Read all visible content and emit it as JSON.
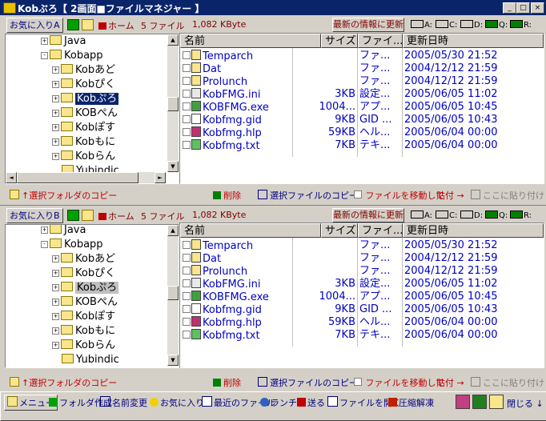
{
  "window": {
    "title": "Kobぶろ【 2画面■ファイルマネジャー 】",
    "btn_min": "_",
    "btn_max": "□",
    "btn_close": "×"
  },
  "pane_top": {
    "fav": "お気に入りA",
    "home": "ホーム",
    "count": "5 ファイル",
    "size": "1,082 KByte",
    "refresh": "最新の情報に更新",
    "drives": [
      "A:",
      "C:",
      "D:",
      "Q:",
      "R:"
    ],
    "tree": [
      {
        "label": "Java",
        "expand": "+"
      },
      {
        "label": "Kobapp",
        "expand": "-"
      },
      {
        "label": "Kobあど",
        "expand": "+"
      },
      {
        "label": "Kobぴく",
        "expand": "+"
      },
      {
        "label": "Kobぷろ",
        "expand": "+"
      },
      {
        "label": "KOBぺん",
        "expand": "+"
      },
      {
        "label": "Kobぽす",
        "expand": "+"
      },
      {
        "label": "Kobもに",
        "expand": "+"
      },
      {
        "label": "Kobらん",
        "expand": "+"
      },
      {
        "label": "Yubindic",
        "expand": ""
      }
    ],
    "columns": {
      "name": "名前",
      "size": "サイズ",
      "type": "ファイ...",
      "date": "更新日時"
    },
    "files": [
      {
        "name": "Temparch",
        "size": "",
        "type": "ファ...",
        "date": "2005/05/30 21:52",
        "icon": "folder-icon"
      },
      {
        "name": "Dat",
        "size": "",
        "type": "ファ...",
        "date": "2004/12/12 21:59",
        "icon": "folder-icon"
      },
      {
        "name": "Prolunch",
        "size": "",
        "type": "ファ...",
        "date": "2004/12/12 21:59",
        "icon": "folder-icon"
      },
      {
        "name": "KobFMG.ini",
        "size": "3KB",
        "type": "設定...",
        "date": "2005/06/05 11:02",
        "icon": "ini-icon"
      },
      {
        "name": "KOBFMG.exe",
        "size": "1004...",
        "type": "アプ...",
        "date": "2005/06/05 10:45",
        "icon": "exe-icon"
      },
      {
        "name": "Kobfmg.gid",
        "size": "9KB",
        "type": "GID ...",
        "date": "2005/06/05 10:43",
        "icon": "gid-icon"
      },
      {
        "name": "Kobfmg.hlp",
        "size": "59KB",
        "type": "ヘル...",
        "date": "2005/06/04 00:00",
        "icon": "help-icon"
      },
      {
        "name": "Kobfmg.txt",
        "size": "7KB",
        "type": "テキ...",
        "date": "2005/06/04 00:00",
        "icon": "txt-icon"
      }
    ]
  },
  "pane_bottom": {
    "fav": "お気に入りB",
    "home": "ホーム",
    "count": "5 ファイル",
    "size": "1,082 KByte",
    "refresh": "最新の情報に更新",
    "drives": [
      "A:",
      "C:",
      "D:",
      "Q:",
      "R:"
    ],
    "tree": [
      {
        "label": "Java",
        "expand": "+"
      },
      {
        "label": "Kobapp",
        "expand": "-"
      },
      {
        "label": "Kobあど",
        "expand": "+"
      },
      {
        "label": "Kobぴく",
        "expand": "+"
      },
      {
        "label": "Kobぷろ",
        "expand": "+"
      },
      {
        "label": "KOBぺん",
        "expand": "+"
      },
      {
        "label": "Kobぽす",
        "expand": "+"
      },
      {
        "label": "Kobもに",
        "expand": "+"
      },
      {
        "label": "Kobらん",
        "expand": "+"
      },
      {
        "label": "Yubindic",
        "expand": ""
      }
    ],
    "columns": {
      "name": "名前",
      "size": "サイズ",
      "type": "ファイ...",
      "date": "更新日時"
    },
    "files": [
      {
        "name": "Temparch",
        "size": "",
        "type": "ファ...",
        "date": "2005/05/30 21:52",
        "icon": "folder-icon"
      },
      {
        "name": "Dat",
        "size": "",
        "type": "ファ...",
        "date": "2004/12/12 21:59",
        "icon": "folder-icon"
      },
      {
        "name": "Prolunch",
        "size": "",
        "type": "ファ...",
        "date": "2004/12/12 21:59",
        "icon": "folder-icon"
      },
      {
        "name": "KobFMG.ini",
        "size": "3KB",
        "type": "設定...",
        "date": "2005/06/05 11:02",
        "icon": "ini-icon"
      },
      {
        "name": "KOBFMG.exe",
        "size": "1004...",
        "type": "アプ...",
        "date": "2005/06/05 10:45",
        "icon": "exe-icon"
      },
      {
        "name": "Kobfmg.gid",
        "size": "9KB",
        "type": "GID ...",
        "date": "2005/06/05 10:43",
        "icon": "gid-icon"
      },
      {
        "name": "Kobfmg.hlp",
        "size": "59KB",
        "type": "ヘル...",
        "date": "2005/06/04 00:00",
        "icon": "help-icon"
      },
      {
        "name": "Kobfmg.txt",
        "size": "7KB",
        "type": "テキ...",
        "date": "2005/06/04 00:00",
        "icon": "txt-icon"
      }
    ]
  },
  "actions": {
    "copy_folder": "↑選択フォルダのコピー",
    "delete": "削除",
    "copy_files": "選択ファイルのコピー",
    "move_files": "ファイルを移動して",
    "paste": "貼付 →",
    "paste_here": "ここに貼り付け"
  },
  "bottom": {
    "menu": "メニュー",
    "mkdir": "フォルダ作成",
    "rename": "名前変更",
    "favorites": "お気に入り",
    "recent": "最近のファイル",
    "launch": "ランチ",
    "send": "送る",
    "open_file": "ファイルを開く",
    "extract": "圧縮解凍",
    "close": "閉じる ↓"
  },
  "colors": {
    "title_bar": "#0a246a",
    "file_text": "#0000c0",
    "action_text": "#c00000",
    "face": "#d4d0c8"
  }
}
